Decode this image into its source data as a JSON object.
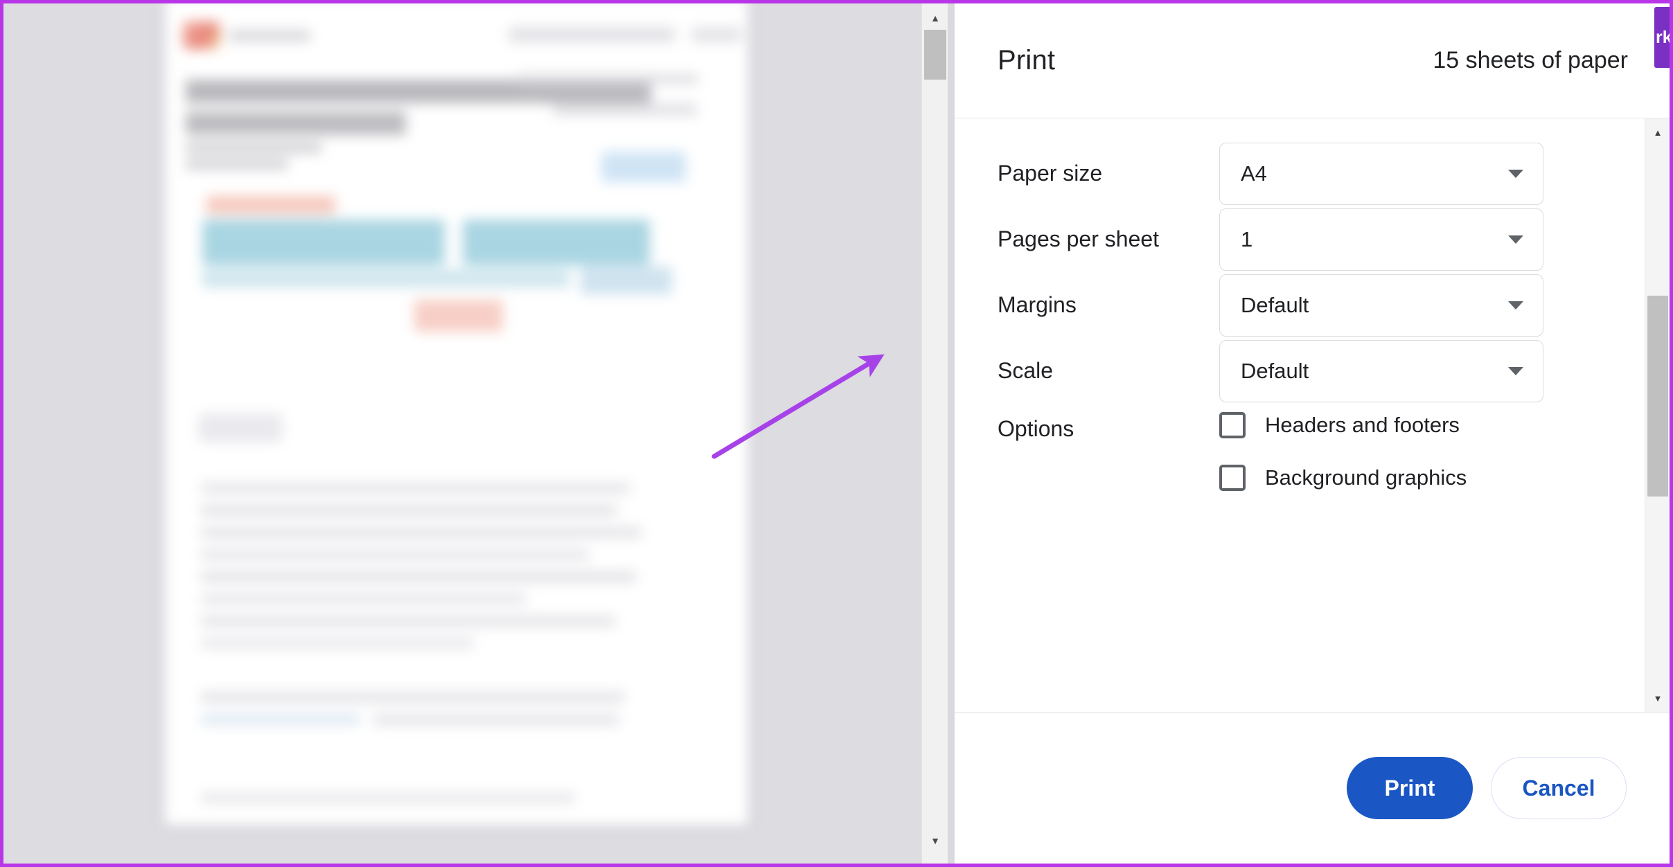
{
  "dialog": {
    "title": "Print",
    "sheet_count": "15 sheets of paper",
    "settings": [
      {
        "label": "Paper size",
        "value": "A4"
      },
      {
        "label": "Pages per sheet",
        "value": "1"
      },
      {
        "label": "Margins",
        "value": "Default"
      },
      {
        "label": "Scale",
        "value": "Default"
      }
    ],
    "options": {
      "label": "Options",
      "items": [
        {
          "label": "Headers and footers",
          "checked": false
        },
        {
          "label": "Background graphics",
          "checked": false
        }
      ]
    },
    "footer": {
      "print_label": "Print",
      "cancel_label": "Cancel"
    }
  },
  "preview": {
    "scrollbar": {
      "up_arrow": "▲",
      "down_arrow": "▼"
    }
  },
  "dialog_scrollbar": {
    "up_arrow": "▲",
    "down_arrow": "▼"
  },
  "bookmark_tab": {
    "label": "rk"
  },
  "colors": {
    "accent_blue": "#1a56c4",
    "annotation_purple": "#a742e8",
    "frame_purple": "#b836e8",
    "bookmark_purple": "#7b30c4"
  }
}
